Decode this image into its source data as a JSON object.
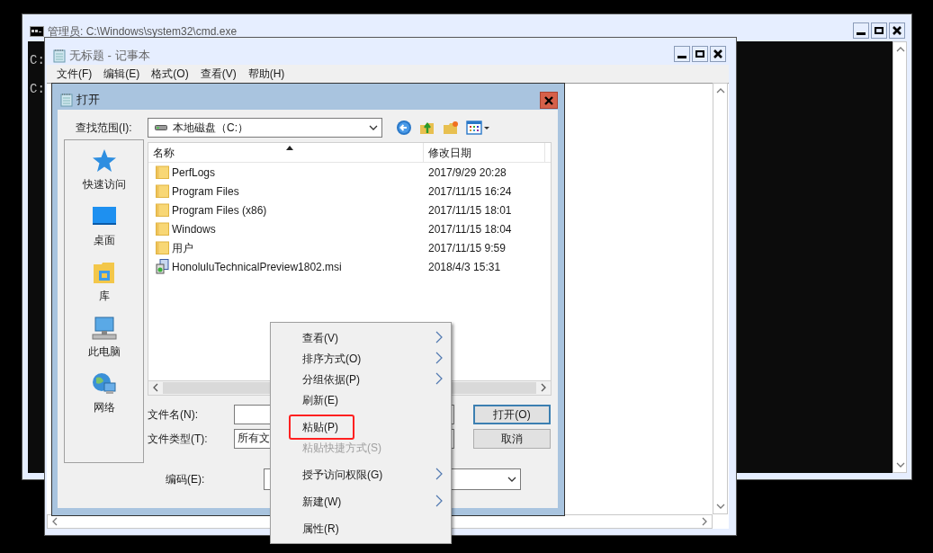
{
  "cmd_window": {
    "title": "管理员: C:\\Windows\\system32\\cmd.exe",
    "lines": [
      "C:",
      "C:"
    ]
  },
  "notepad_window": {
    "title": "无标题 - 记事本",
    "menu": [
      "文件(F)",
      "编辑(E)",
      "格式(O)",
      "查看(V)",
      "帮助(H)"
    ]
  },
  "open_dialog": {
    "title": "打开",
    "look_in_label": "查找范围(I):",
    "look_in_value": "本地磁盘（C:）",
    "places": [
      {
        "label": "快速访问",
        "kind": "quick"
      },
      {
        "label": "桌面",
        "kind": "desktop"
      },
      {
        "label": "库",
        "kind": "library"
      },
      {
        "label": "此电脑",
        "kind": "computer"
      },
      {
        "label": "网络",
        "kind": "network"
      }
    ],
    "columns": [
      {
        "label": "名称",
        "sorted": true
      },
      {
        "label": "修改日期",
        "sorted": false
      }
    ],
    "files": [
      {
        "name": "PerfLogs",
        "modified": "2017/9/29 20:28",
        "kind": "folder"
      },
      {
        "name": "Program Files",
        "modified": "2017/11/15 16:24",
        "kind": "folder"
      },
      {
        "name": "Program Files (x86)",
        "modified": "2017/11/15 18:01",
        "kind": "folder"
      },
      {
        "name": "Windows",
        "modified": "2017/11/15 18:04",
        "kind": "folder"
      },
      {
        "name": "用户",
        "modified": "2017/11/15 9:59",
        "kind": "folder"
      },
      {
        "name": "HonoluluTechnicalPreview1802.msi",
        "modified": "2018/4/3 15:31",
        "kind": "installer"
      }
    ],
    "file_name_label": "文件名(N):",
    "file_type_label": "文件类型(T):",
    "file_type_value": "所有文",
    "encoding_label": "编码(E):",
    "buttons": [
      {
        "label": "打开(O)",
        "default": true
      },
      {
        "label": "取消",
        "default": false
      }
    ]
  },
  "context_menu": {
    "items": [
      {
        "kind": "item",
        "label": "查看(V)",
        "submenu": true,
        "disabled": false,
        "highlighted": false
      },
      {
        "kind": "item",
        "label": "排序方式(O)",
        "submenu": true,
        "disabled": false,
        "highlighted": false
      },
      {
        "kind": "item",
        "label": "分组依据(P)",
        "submenu": true,
        "disabled": false,
        "highlighted": false
      },
      {
        "kind": "item",
        "label": "刷新(E)",
        "submenu": false,
        "disabled": false,
        "highlighted": false
      },
      {
        "kind": "separator"
      },
      {
        "kind": "item",
        "label": "粘贴(P)",
        "submenu": false,
        "disabled": false,
        "highlighted": true
      },
      {
        "kind": "item",
        "label": "粘贴快捷方式(S)",
        "submenu": false,
        "disabled": true,
        "highlighted": false
      },
      {
        "kind": "separator"
      },
      {
        "kind": "item",
        "label": "授予访问权限(G)",
        "submenu": true,
        "disabled": false,
        "highlighted": false
      },
      {
        "kind": "separator"
      },
      {
        "kind": "item",
        "label": "新建(W)",
        "submenu": true,
        "disabled": false,
        "highlighted": false
      },
      {
        "kind": "separator"
      },
      {
        "kind": "item",
        "label": "属性(R)",
        "submenu": false,
        "disabled": false,
        "highlighted": false
      }
    ]
  }
}
